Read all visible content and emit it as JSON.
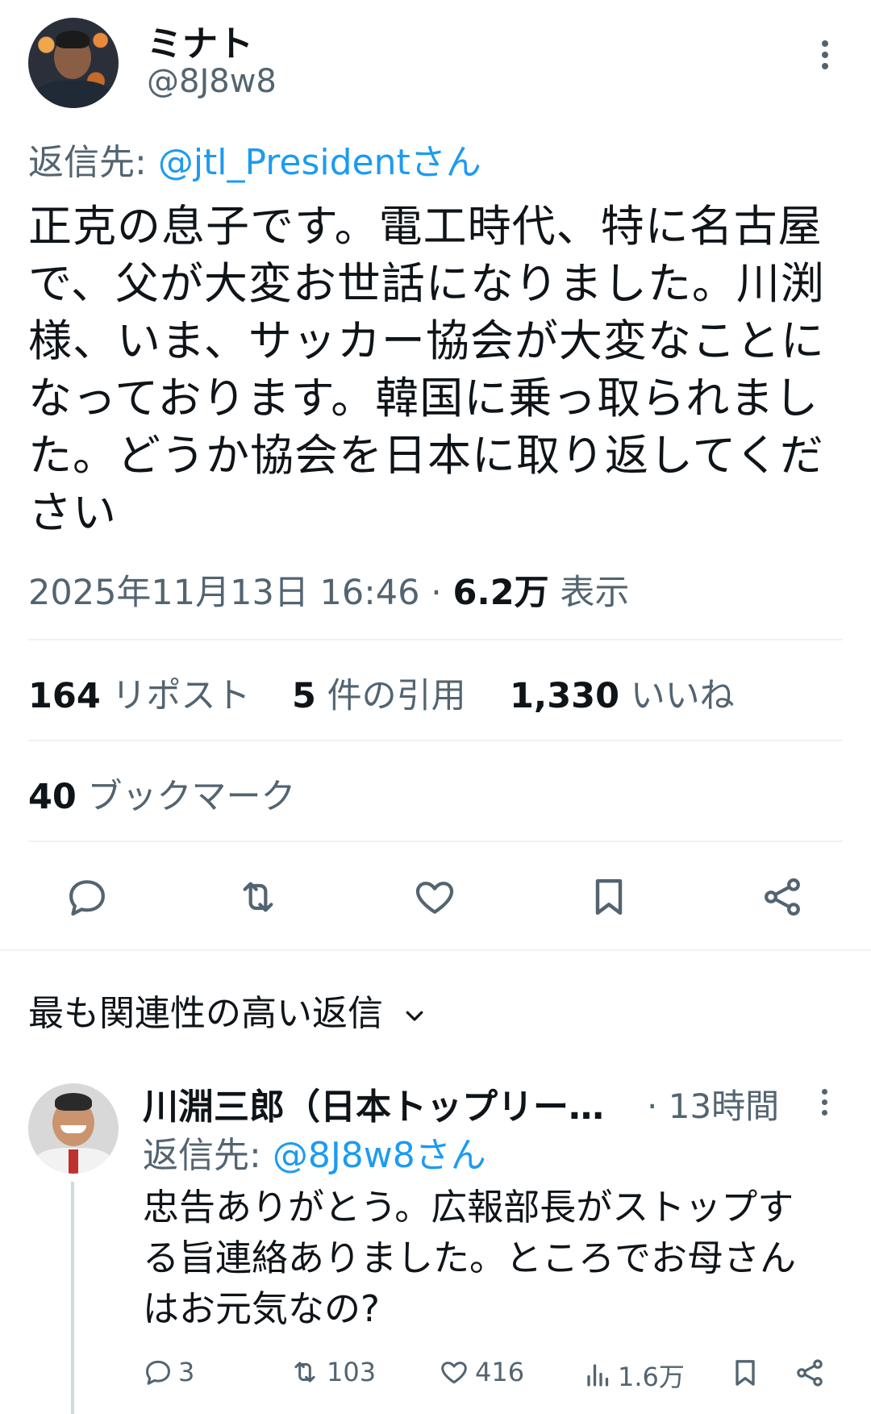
{
  "tweet": {
    "display_name": "ミナト",
    "handle": "@8J8w8",
    "reply_prefix": "返信先:",
    "reply_to": "@jtl_Presidentさん",
    "text_lines": [
      "正克の息子です。電工時代、特に名古屋",
      "で、父が大変お世話になりました。川渕",
      "様、いま、サッカー協会が大変なことに",
      "なっております。韓国に乗っ取られまし",
      "た。どうか協会を日本に取り返してくだ",
      "さい"
    ],
    "timestamp": "2025年11月13日 16:46",
    "separator": "·",
    "views_count": "6.2万",
    "views_label": "表示",
    "reposts_count": "164",
    "reposts_label": "リポスト",
    "quotes_count": "5",
    "quotes_label": "件の引用",
    "likes_count": "1,330",
    "likes_label": "いいね",
    "bookmarks_count": "40",
    "bookmarks_label": "ブックマーク"
  },
  "replies_section": {
    "title": "最も関連性の高い返信"
  },
  "reply": {
    "display_name": "川淵三郎（日本トップリー…",
    "separator": "·",
    "time": "13時間",
    "reply_prefix": "返信先:",
    "reply_to": "@8J8w8さん",
    "text_lines": [
      "忠告ありがとう。広報部長がストップす",
      "る旨連絡ありました。ところでお母さん",
      "はお元気なの?"
    ],
    "replies": "3",
    "reposts": "103",
    "likes": "416",
    "views": "1.6万"
  },
  "icons": {
    "reply": "reply-icon",
    "repost": "repost-icon",
    "like": "heart-icon",
    "bookmark": "bookmark-icon",
    "share": "share-icon",
    "more": "more-icon",
    "chevron": "chevron-down-icon",
    "views": "views-icon"
  },
  "colors": {
    "link": "#1d9bf0",
    "muted": "#536471",
    "text": "#0f1419",
    "divider": "#eff3f4"
  }
}
